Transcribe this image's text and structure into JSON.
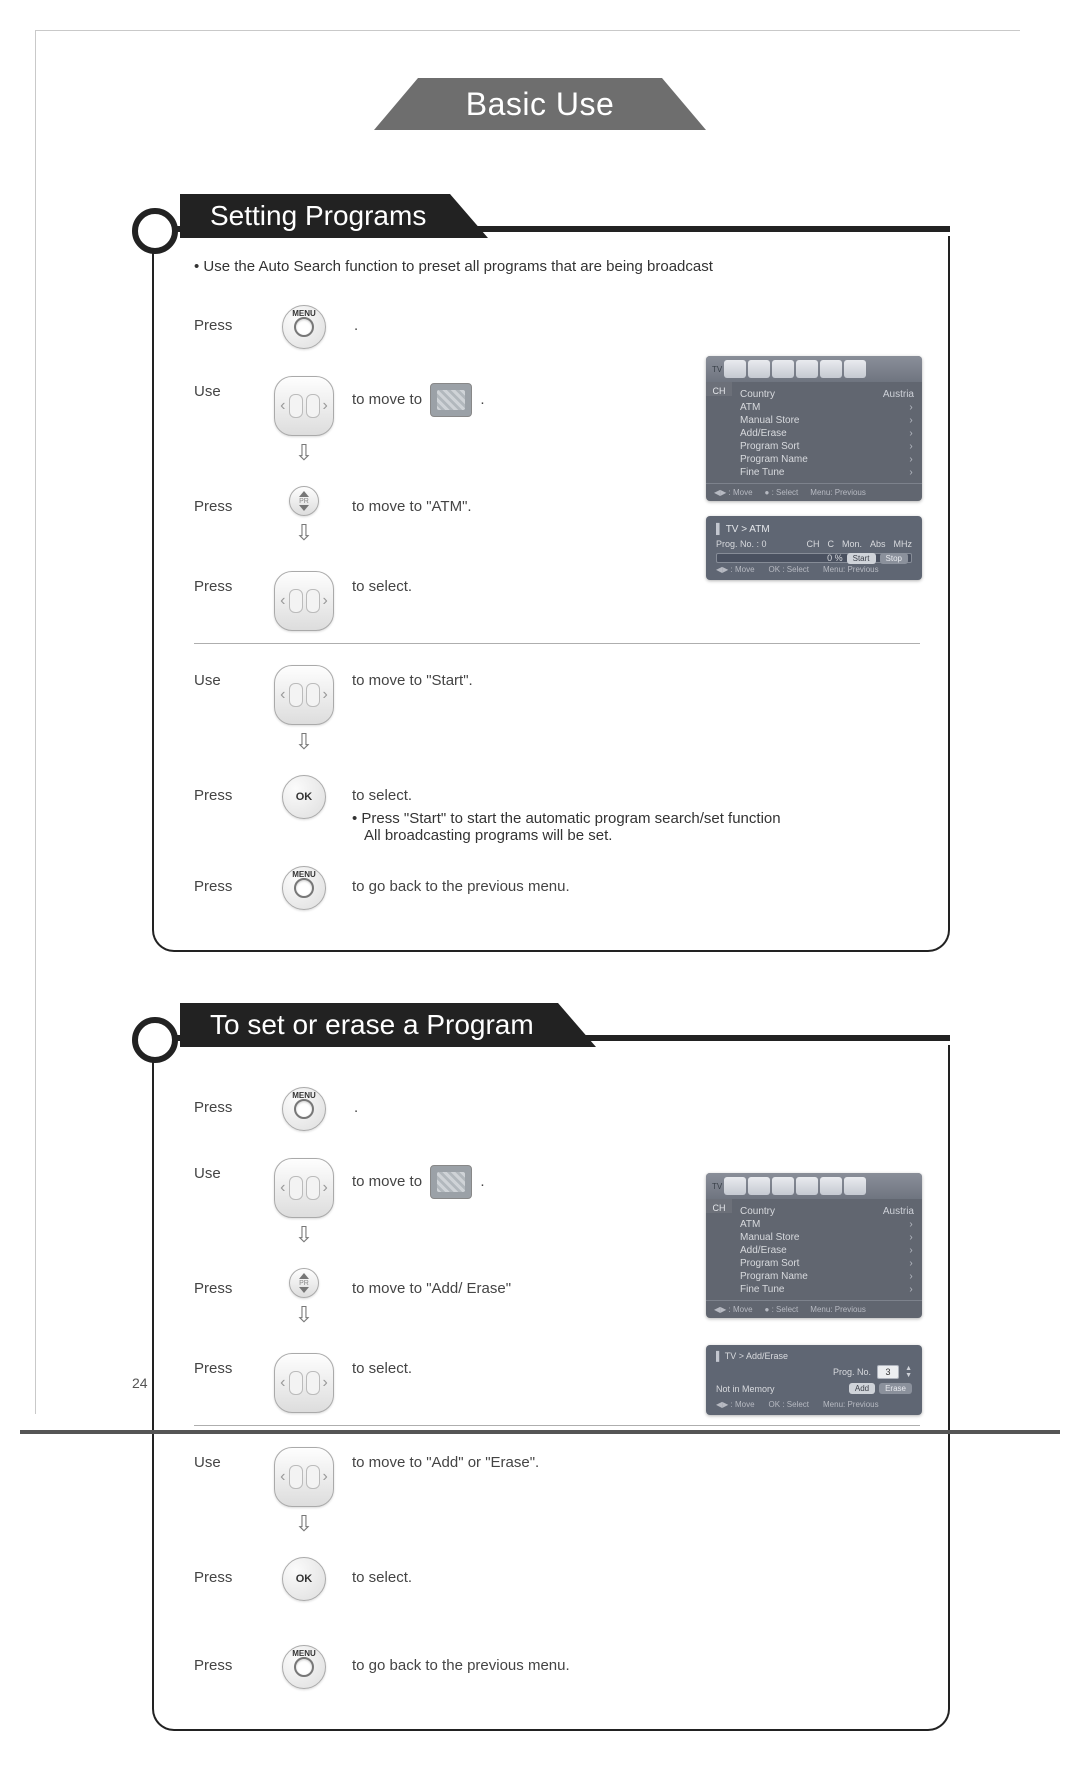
{
  "header": {
    "tab": "Basic Use"
  },
  "page_number": "24",
  "sections": [
    {
      "title": "Setting Programs",
      "intro": "Use the Auto Search function to preset all programs that are being broadcast",
      "steps": [
        {
          "word": "Press",
          "btn": "menu",
          "text_after": "."
        },
        {
          "word": "Use",
          "btn": "rocker",
          "text_before": "to move to",
          "screen": true,
          "text_after": ".",
          "arrow": true
        },
        {
          "word": "Press",
          "btn": "vrocker",
          "text_after": "to move to \"ATM\".",
          "arrow": true
        },
        {
          "word": "Press",
          "btn": "rocker",
          "text_after": "to select."
        },
        {
          "word": "Use",
          "btn": "rocker",
          "text_after": "to move to \"Start\".",
          "hr": true,
          "arrow": true
        },
        {
          "word": "Press",
          "btn": "ok",
          "text_after": "to select.",
          "subnote1": "Press \"Start\" to start the automatic program search/set function",
          "subnote2": "All broadcasting programs will be set."
        },
        {
          "word": "Press",
          "btn": "menu",
          "text_after": "to go back to the previous menu."
        }
      ],
      "osd_a": {
        "left": "CH",
        "rows": [
          {
            "k": "Country",
            "v": "Austria"
          },
          {
            "k": "ATM",
            "v": ""
          },
          {
            "k": "Manual Store",
            "v": ""
          },
          {
            "k": "Add/Erase",
            "v": ""
          },
          {
            "k": "Program Sort",
            "v": ""
          },
          {
            "k": "Program Name",
            "v": ""
          },
          {
            "k": "Fine Tune",
            "v": ""
          }
        ],
        "footer": [
          "◀▶ : Move",
          "● : Select",
          "Menu: Previous"
        ]
      },
      "osd_b": {
        "crumb": "TV > ATM",
        "line1": {
          "label": "Prog. No. : 0",
          "fields": [
            "CH",
            "C",
            "Mon.",
            "Abs",
            "MHz"
          ]
        },
        "bar_right": [
          "0 %",
          "Start",
          "Stop"
        ],
        "footer": [
          "◀▶ : Move",
          "OK : Select",
          "Menu: Previous"
        ]
      }
    },
    {
      "title": "To set or erase a Program",
      "steps": [
        {
          "word": "Press",
          "btn": "menu",
          "text_after": "."
        },
        {
          "word": "Use",
          "btn": "rocker",
          "text_before": "to move to",
          "screen": true,
          "text_after": ".",
          "arrow": true
        },
        {
          "word": "Press",
          "btn": "vrocker",
          "text_after": "to move to \"Add/ Erase\"",
          "arrow": true
        },
        {
          "word": "Press",
          "btn": "rocker",
          "text_after": "to select."
        },
        {
          "word": "Use",
          "btn": "rocker",
          "text_after": "to move to  \"Add\" or \"Erase\".",
          "hr": true,
          "arrow": true
        },
        {
          "word": "Press",
          "btn": "ok",
          "text_after": "to select."
        },
        {
          "word": "Press",
          "btn": "menu",
          "text_after": "to go back to the previous menu.",
          "gap": true
        }
      ],
      "osd_a": {
        "left": "CH",
        "rows": [
          {
            "k": "Country",
            "v": "Austria"
          },
          {
            "k": "ATM",
            "v": ""
          },
          {
            "k": "Manual Store",
            "v": ""
          },
          {
            "k": "Add/Erase",
            "v": ""
          },
          {
            "k": "Program Sort",
            "v": ""
          },
          {
            "k": "Program Name",
            "v": ""
          },
          {
            "k": "Fine Tune",
            "v": ""
          }
        ],
        "footer": [
          "◀▶ : Move",
          "● : Select",
          "Menu: Previous"
        ]
      },
      "osd_c": {
        "crumb": "TV > Add/Erase",
        "prog_label": "Prog. No.",
        "prog_val": "3",
        "status": "Not in Memory",
        "btn1": "Add",
        "btn2": "Erase",
        "footer": [
          "◀▶ : Move",
          "OK : Select",
          "Menu: Previous"
        ]
      }
    }
  ]
}
